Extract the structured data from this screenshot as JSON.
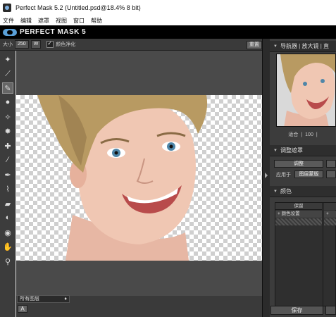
{
  "window": {
    "title": "Perfect Mask 5.2 (Untitled.psd@18.4% 8 bit)"
  },
  "menu": [
    "文件",
    "编辑",
    "遮罩",
    "视图",
    "窗口",
    "帮助"
  ],
  "brand": {
    "name": "PERFECT MASK 5"
  },
  "options": {
    "size_label": "大小",
    "size_value": "250",
    "w_button": "W",
    "color_clean_label": "颜色净化",
    "reset_button": "重置"
  },
  "tools": [
    "magic-wand-keep-icon",
    "magic-wand-drop-icon",
    "magic-brush-icon",
    "blob-icon",
    "magic-wand-neutral-icon",
    "splat-icon",
    "magic-wand-plus-icon",
    "dropper-icon",
    "pen-icon",
    "brush-icon",
    "eraser-icon",
    "bucket-icon",
    "blur-icon",
    "hand-icon",
    "zoom-icon"
  ],
  "bottom": {
    "view_select": "所有图层",
    "a_button": "A"
  },
  "navigator": {
    "tabs": "导航器 | 放大镜 | 直",
    "zoom_mode": "适合",
    "zoom_value": "100"
  },
  "adjust_mask": {
    "title": "调整遮罩",
    "adjust_button": "调整",
    "apply_to_label": "应用于",
    "apply_to_value": "图层蒙版"
  },
  "color_panel": {
    "title": "颜色",
    "col_header": "保留",
    "row1": "颜色设置"
  },
  "save_button": "保存",
  "colors": {
    "accent": "#5aa0d8",
    "panel": "#3c3c3c",
    "canvas": "#4a4a4a"
  }
}
